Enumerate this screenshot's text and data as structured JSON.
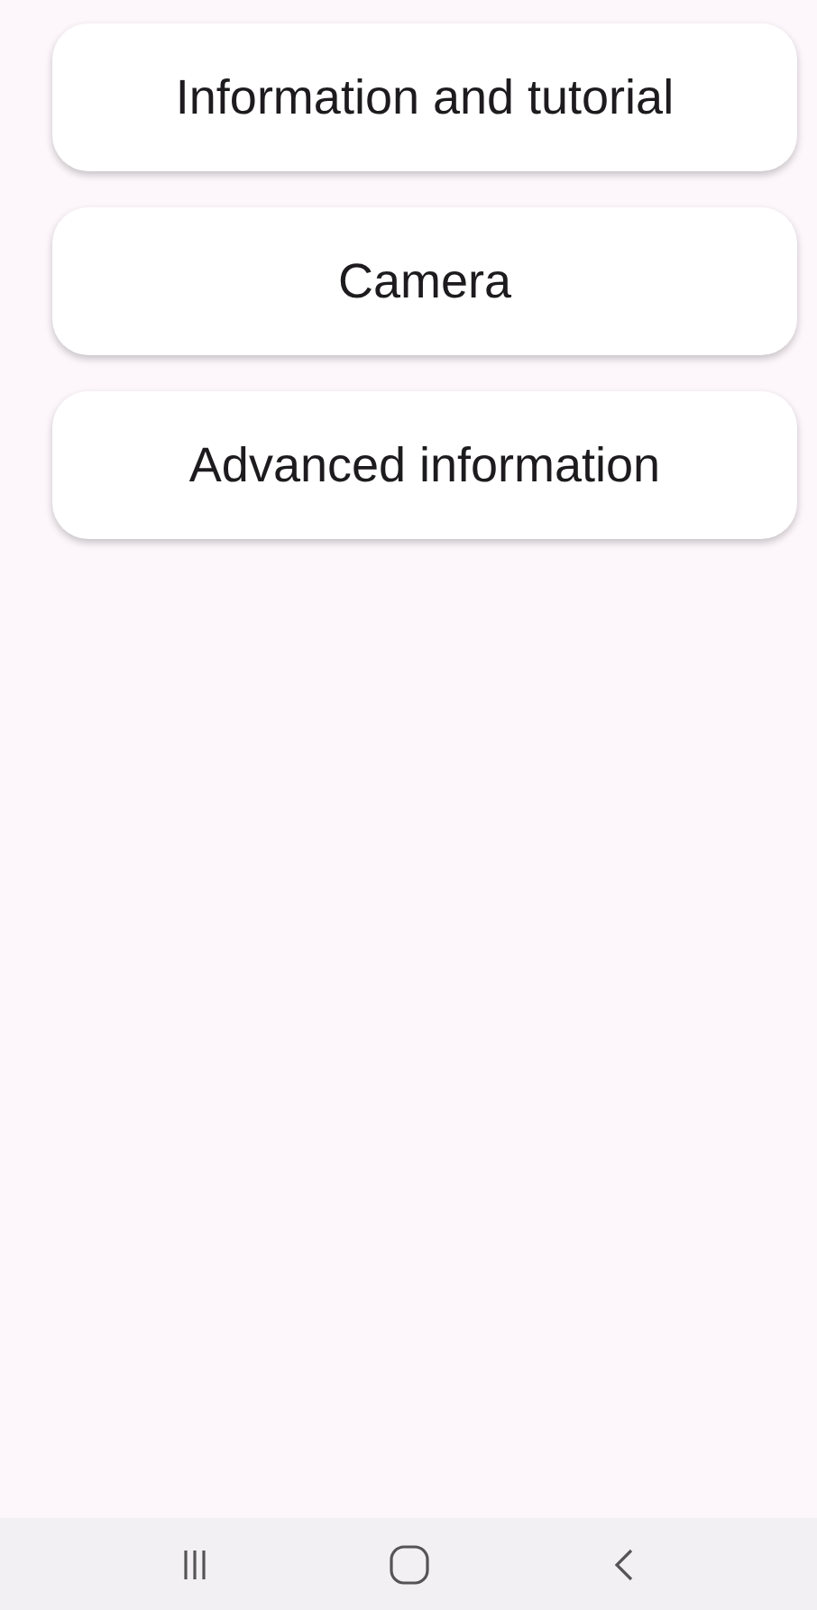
{
  "menu_buttons": [
    {
      "label": "Information and tutorial"
    },
    {
      "label": "Camera"
    },
    {
      "label": "Advanced information"
    }
  ],
  "nav_bar": {
    "buttons": [
      {
        "kind": "recents"
      },
      {
        "kind": "home"
      },
      {
        "kind": "back"
      }
    ]
  }
}
